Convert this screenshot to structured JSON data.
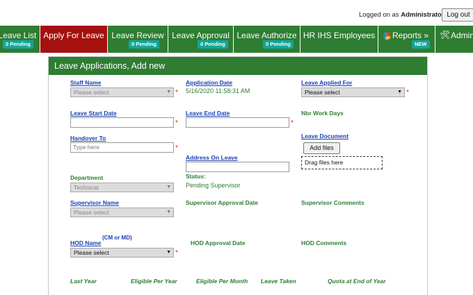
{
  "header": {
    "logged_on_prefix": "Logged on as",
    "user": "Administrator",
    "logout_label": "Log out"
  },
  "nav": [
    {
      "label": "Leave List",
      "badge": "0 Pending"
    },
    {
      "label": "Apply For Leave",
      "badge": "",
      "active": true
    },
    {
      "label": "Leave Review",
      "badge": "0 Pending"
    },
    {
      "label": "Leave Approval",
      "badge": "0 Pending"
    },
    {
      "label": "Leave Authorize",
      "badge": "0 Pending"
    },
    {
      "label": "HR IHS Employees",
      "badge": ""
    },
    {
      "label": "Reports »",
      "badge": "NEW",
      "icon": "pie-chart-icon"
    },
    {
      "label": "Admin",
      "badge": "",
      "icon": "tools-icon"
    }
  ],
  "panel": {
    "title": "Leave Applications, Add new"
  },
  "form": {
    "staff_name": {
      "label": "Staff Name",
      "placeholder": "Please select"
    },
    "application_date": {
      "label": "Application Date",
      "value": "5/16/2020 11:58:31 AM"
    },
    "leave_applied_for": {
      "label": "Leave Applied For",
      "value": "Please select"
    },
    "leave_start_date": {
      "label": "Leave Start Date",
      "value": ""
    },
    "leave_end_date": {
      "label": "Leave End Date",
      "value": ""
    },
    "nbr_work_days": {
      "label": "Nbr Work Days"
    },
    "handover_to": {
      "label": "Handover To",
      "placeholder": "Type here"
    },
    "leave_document": {
      "label": "Leave Document",
      "add_files": "Add files",
      "drop": "Drag files here"
    },
    "address_on_leave": {
      "label": "Address On Leave",
      "value": ""
    },
    "department": {
      "label": "Department",
      "value": "Technical"
    },
    "status": {
      "label": "Status:",
      "value": "Pending Supervisor"
    },
    "supervisor_name": {
      "label": "Supervisor Name",
      "placeholder": "Please select"
    },
    "supervisor_approval_date": {
      "label": "Supervisor Approval Date"
    },
    "supervisor_comments": {
      "label": "Supervisor Comments"
    },
    "hod_name": {
      "label": "HOD Name",
      "sup": "(CM or MD)",
      "value": "Please select"
    },
    "hod_approval_date": {
      "label": "HOD Approval Date"
    },
    "hod_comments": {
      "label": "HOD Comments"
    }
  },
  "balance_headers": [
    "Last Year",
    "Eligible Per Year",
    "Eligible Per Month",
    "Leave Taken",
    "Quota at End of Year"
  ],
  "colors": {
    "nav_green": "#2e7d32",
    "active_red": "#a4110f",
    "badge_teal": "#13a69a",
    "link_blue": "#1a3fb0",
    "required_red": "#dd2222"
  }
}
